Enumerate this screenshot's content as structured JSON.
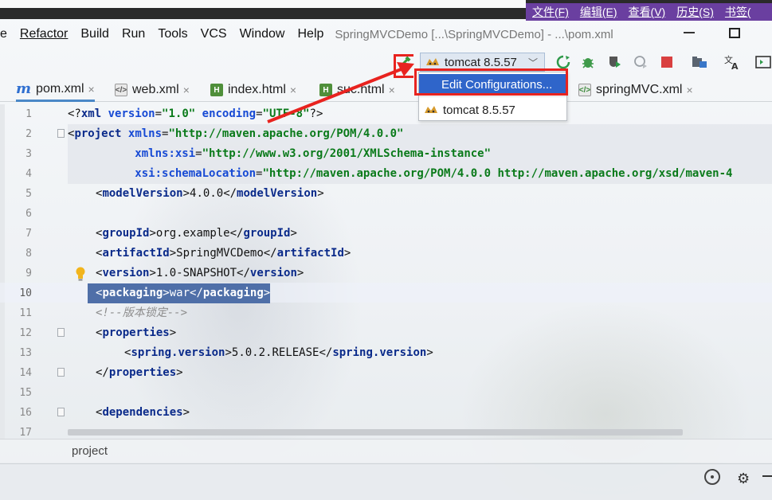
{
  "cn_menu": [
    "文件(F)",
    "编辑(E)",
    "查看(V)",
    "历史(S)",
    "书签("
  ],
  "menu": [
    "e",
    "Refactor",
    "Build",
    "Run",
    "Tools",
    "VCS",
    "Window",
    "Help"
  ],
  "window_title": "SpringMVCDemo [...\\SpringMVCDemo] - ...\\pom.xml",
  "run_config": {
    "label": "tomcat 8.5.57"
  },
  "dropdown": {
    "selected": "Edit Configurations...",
    "item": "tomcat 8.5.57"
  },
  "tabs": [
    {
      "label": "pom.xml",
      "close": "×"
    },
    {
      "label": "web.xml",
      "close": "×"
    },
    {
      "label": "index.html",
      "close": "×"
    },
    {
      "label": "suc.html",
      "close": "×"
    },
    {
      "label": "springMVC.xml",
      "close": "×"
    }
  ],
  "line_numbers": [
    "1",
    "2",
    "3",
    "4",
    "5",
    "6",
    "7",
    "8",
    "9",
    "10",
    "11",
    "12",
    "13",
    "14",
    "15",
    "16",
    "17"
  ],
  "code": {
    "l1_a": "<?",
    "l1_tag": "xml",
    "l1_attr1": "version",
    "l1_val1": "\"1.0\"",
    "l1_attr2": "encoding",
    "l1_val2": "\"UTF-8\"",
    "l1_end": "?>",
    "l2_tag": "project",
    "l2_attr": "xmlns",
    "l2_val": "\"http://maven.apache.org/POM/4.0.0\"",
    "l3_attr": "xmlns:xsi",
    "l3_val": "\"http://www.w3.org/2001/XMLSchema-instance\"",
    "l4_attr": "xsi:schemaLocation",
    "l4_val": "\"http://maven.apache.org/POM/4.0.0 http://maven.apache.org/xsd/maven-4",
    "l5_tag": "modelVersion",
    "l5_text": "4.0.0",
    "l7_tag": "groupId",
    "l7_text": "org.example",
    "l8_tag": "artifactId",
    "l8_text": "SpringMVCDemo",
    "l9_tag": "version",
    "l9_text": "1.0-SNAPSHOT",
    "l10_tag": "packaging",
    "l10_text": "war",
    "l11_comment": "<!--版本锁定-->",
    "l12_tag": "properties",
    "l13_tag": "spring.version",
    "l13_text": "5.0.2.RELEASE",
    "l14_tag": "properties",
    "l16_tag": "dependencies"
  },
  "breadcrumb": "project"
}
